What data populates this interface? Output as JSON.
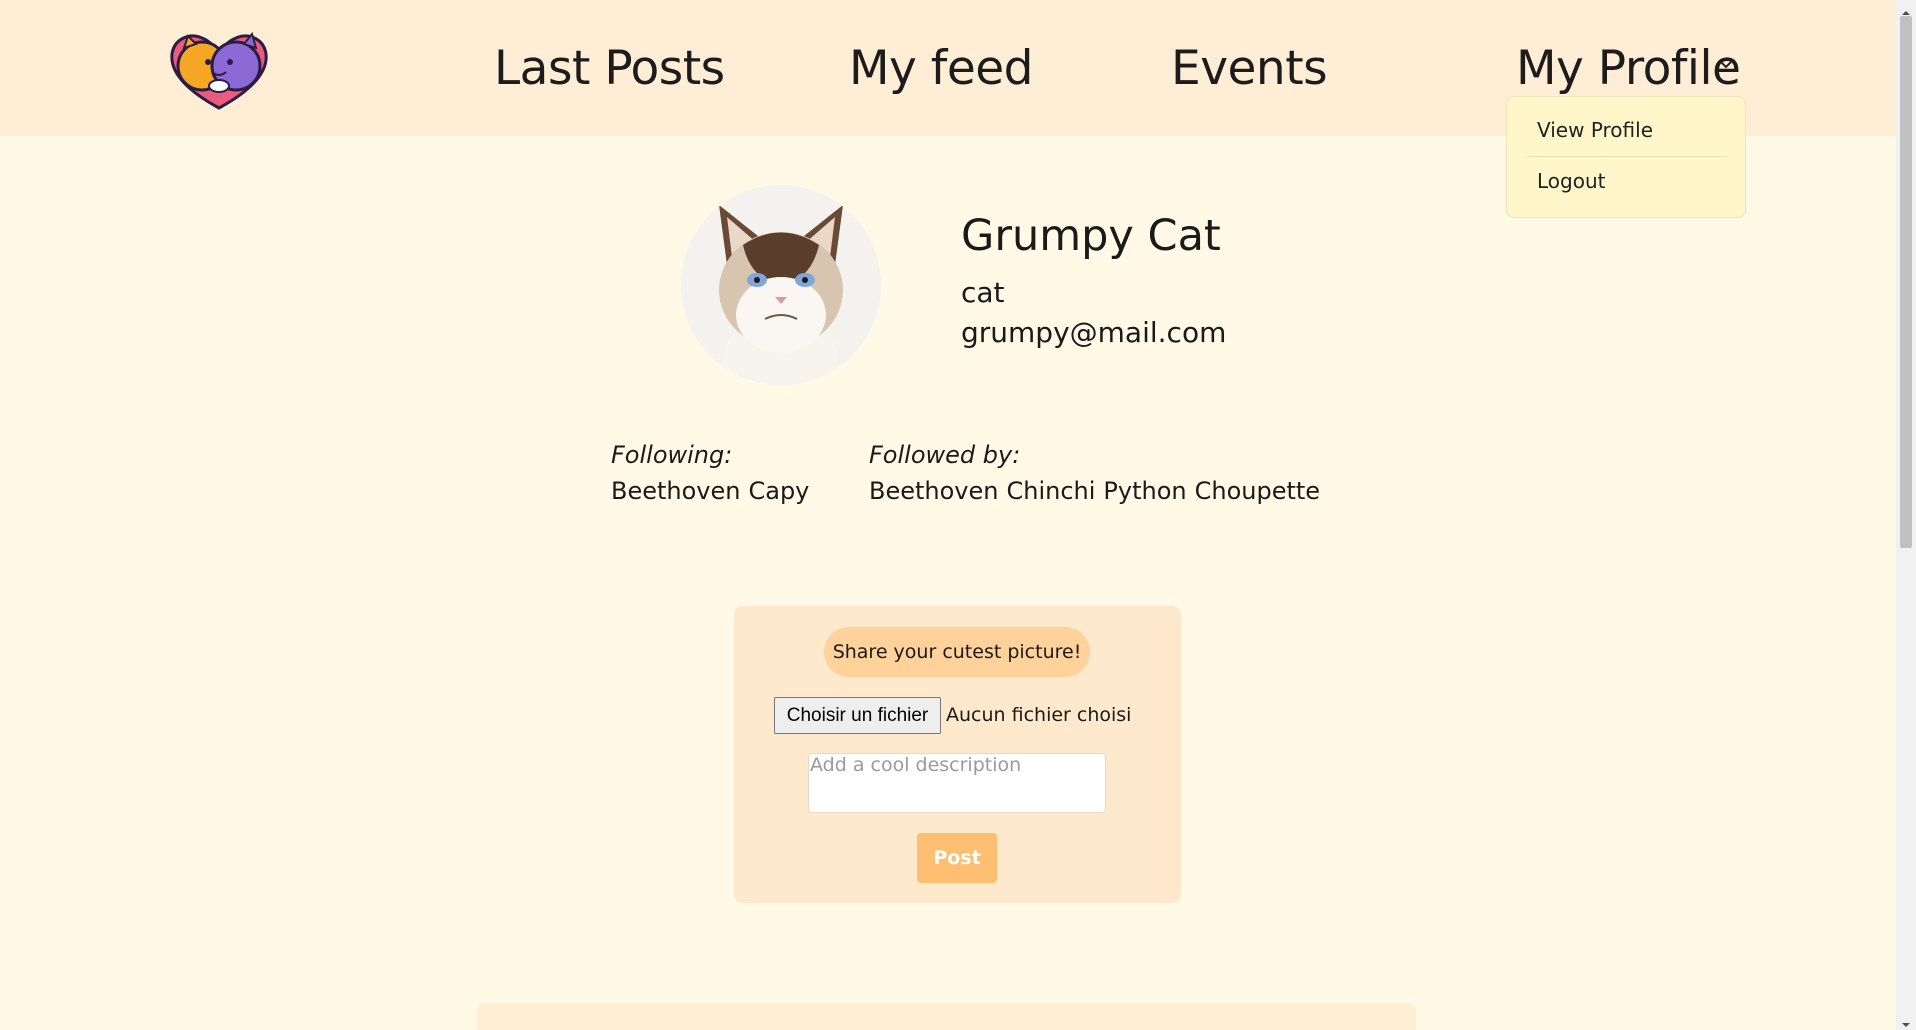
{
  "nav": {
    "links": [
      "Last Posts",
      "My feed",
      "Events",
      "My Profile"
    ],
    "dropdown": {
      "view_profile": "View Profile",
      "logout": "Logout"
    }
  },
  "profile": {
    "name": "Grumpy Cat",
    "species": "cat",
    "email": "grumpy@mail.com",
    "following_label": "Following:",
    "following": [
      "Beethoven",
      "Capy"
    ],
    "followed_label": "Followed by:",
    "followed_by": [
      "Beethoven",
      "Chinchi",
      "Python",
      "Choupette"
    ]
  },
  "post_form": {
    "share_label": "Share your cutest picture!",
    "file_button": "Choisir un fichier",
    "file_status": "Aucun fichier choisi",
    "description_placeholder": "Add a cool description",
    "post_button": "Post"
  },
  "colors": {
    "nav_bg": "#ffeed5",
    "page_bg": "#fff9e6",
    "dropdown_bg": "#fff6c9",
    "card_bg": "#ffe9cc",
    "pill_bg": "#ffd19b",
    "post_button_bg": "#ffbf72"
  },
  "icons": [
    "logo-icon",
    "chevron-down-icon",
    "resize-handle-icon"
  ]
}
